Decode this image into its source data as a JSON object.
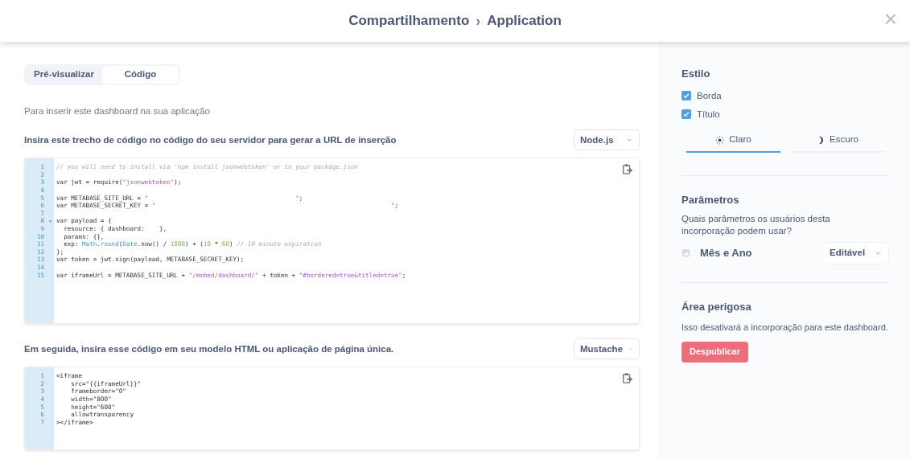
{
  "header": {
    "breadcrumb": [
      "Compartilhamento",
      "Application"
    ],
    "separator": "›",
    "close": "×"
  },
  "tabs": [
    {
      "label": "Pré-visualizar",
      "selected": false
    },
    {
      "label": "Código",
      "selected": true
    }
  ],
  "intro": "Para inserir este dashboard na sua aplicação",
  "sections": [
    {
      "instruction": "Insira este trecho de código no código do seu servidor para gerar a URL de inserção",
      "language": "Node.js",
      "code": [
        {
          "number": "1",
          "foldable": false,
          "tokens": [
            {
              "kind": "comment",
              "text": "// you will need to install via 'npm install jsonwebtoken' or in your package.json"
            }
          ]
        },
        {
          "number": "2",
          "foldable": false
        },
        {
          "number": "3",
          "foldable": false,
          "tokens": [
            {
              "kind": "plain",
              "text": "var jwt = require("
            },
            {
              "kind": "string",
              "text": "\"jsonwebtoken\""
            },
            {
              "kind": "plain",
              "text": ");"
            }
          ]
        },
        {
          "number": "4",
          "foldable": false
        },
        {
          "number": "5",
          "foldable": false,
          "tokens": [
            {
              "kind": "plain",
              "text": "var METABASE_SITE_URL = "
            },
            {
              "kind": "string",
              "text": "\"                                        \""
            },
            {
              "kind": "plain",
              "text": ";"
            }
          ]
        },
        {
          "number": "6",
          "foldable": false,
          "tokens": [
            {
              "kind": "plain",
              "text": "var METABASE_SECRET_KEY = "
            },
            {
              "kind": "string",
              "text": "\"                                                                \""
            },
            {
              "kind": "plain",
              "text": ";"
            }
          ]
        },
        {
          "number": "7",
          "foldable": false
        },
        {
          "number": "8",
          "foldable": true,
          "tokens": [
            {
              "kind": "plain",
              "text": "var payload = {"
            }
          ]
        },
        {
          "number": "9",
          "foldable": false,
          "tokens": [
            {
              "kind": "plain",
              "text": "  resource: { dashboard:    },"
            }
          ]
        },
        {
          "number": "10",
          "foldable": false,
          "tokens": [
            {
              "kind": "plain",
              "text": "  params: {},"
            }
          ]
        },
        {
          "number": "11",
          "foldable": false,
          "tokens": [
            {
              "kind": "plain",
              "text": "  exp: "
            },
            {
              "kind": "builtin",
              "text": "Math"
            },
            {
              "kind": "plain",
              "text": "."
            },
            {
              "kind": "builtin",
              "text": "round"
            },
            {
              "kind": "plain",
              "text": "("
            },
            {
              "kind": "builtin",
              "text": "Date"
            },
            {
              "kind": "plain",
              "text": ".now() / "
            },
            {
              "kind": "number",
              "text": "1000"
            },
            {
              "kind": "plain",
              "text": ") + ("
            },
            {
              "kind": "number",
              "text": "10"
            },
            {
              "kind": "plain",
              "text": " * "
            },
            {
              "kind": "number",
              "text": "60"
            },
            {
              "kind": "plain",
              "text": ") "
            },
            {
              "kind": "comment",
              "text": "// 10 minute expiration"
            }
          ]
        },
        {
          "number": "12",
          "foldable": false,
          "tokens": [
            {
              "kind": "plain",
              "text": "};"
            }
          ]
        },
        {
          "number": "13",
          "foldable": false,
          "tokens": [
            {
              "kind": "plain",
              "text": "var token = jwt.sign(payload, METABASE_SECRET_KEY);"
            }
          ]
        },
        {
          "number": "14",
          "foldable": false
        },
        {
          "number": "15",
          "foldable": false,
          "tokens": [
            {
              "kind": "plain",
              "text": "var iframeUrl = METABASE_SITE_URL + "
            },
            {
              "kind": "string",
              "text": "\"/embed/dashboard/\""
            },
            {
              "kind": "plain",
              "text": " + token + "
            },
            {
              "kind": "string",
              "text": "\"#bordered=true&titled=true\""
            },
            {
              "kind": "plain",
              "text": ";"
            }
          ]
        }
      ]
    },
    {
      "instruction": "Em seguida, insira esse código em seu modelo HTML ou aplicação de página única.",
      "language": "Mustache",
      "code": [
        {
          "number": "1",
          "foldable": false,
          "tokens": [
            {
              "kind": "plain",
              "text": "<iframe"
            }
          ]
        },
        {
          "number": "2",
          "foldable": false,
          "tokens": [
            {
              "kind": "plain",
              "text": "    src=\"{{iframeUrl}}\""
            }
          ]
        },
        {
          "number": "3",
          "foldable": false,
          "tokens": [
            {
              "kind": "plain",
              "text": "    frameborder=\"0\""
            }
          ]
        },
        {
          "number": "4",
          "foldable": false,
          "tokens": [
            {
              "kind": "plain",
              "text": "    width=\"800\""
            }
          ]
        },
        {
          "number": "5",
          "foldable": false,
          "tokens": [
            {
              "kind": "plain",
              "text": "    height=\"600\""
            }
          ]
        },
        {
          "number": "6",
          "foldable": false,
          "tokens": [
            {
              "kind": "plain",
              "text": "    allowtransparency"
            }
          ]
        },
        {
          "number": "7",
          "foldable": false,
          "tokens": [
            {
              "kind": "plain",
              "text": "></iframe>"
            }
          ]
        }
      ]
    }
  ],
  "sidebar": {
    "style": {
      "title": "Estilo",
      "options": [
        {
          "label": "Borda",
          "checked": true
        },
        {
          "label": "Título",
          "checked": true
        }
      ],
      "themes": [
        {
          "label": "Claro",
          "kind": "light",
          "selected": true
        },
        {
          "label": "Escuro",
          "kind": "dark",
          "selected": false
        }
      ]
    },
    "parameters": {
      "title": "Parâmetros",
      "description": "Quais parâmetros os usuários desta incorporação podem usar?",
      "items": [
        {
          "name": "Mês e Ano",
          "mode": "Editável"
        }
      ]
    },
    "danger": {
      "title": "Área perigosa",
      "description": "Isso desativará a incorporação para este dashboard.",
      "button": "Despublicar"
    }
  }
}
